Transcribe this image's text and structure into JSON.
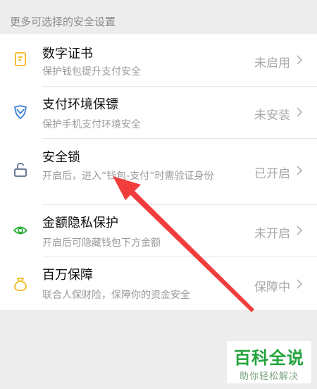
{
  "section_header": "更多可选择的安全设置",
  "items": [
    {
      "title": "数字证书",
      "subtitle": "保护钱包提升支付安全",
      "status": "未启用",
      "icon": "certificate-icon",
      "icon_color": "#f2b91c"
    },
    {
      "title": "支付环境保镖",
      "subtitle": "保护手机支付环境安全",
      "status": "未安装",
      "icon": "shield-icon",
      "icon_color": "#3d7fd6"
    },
    {
      "title": "安全锁",
      "subtitle": "开启后，进入“钱包-支付”时需验证身份",
      "status": "已开启",
      "icon": "lock-icon",
      "icon_color": "#5a6b8c"
    },
    {
      "title": "金额隐私保护",
      "subtitle": "开启后可隐藏钱包下方金额",
      "status": "未开启",
      "icon": "eye-icon",
      "icon_color": "#2aae3a"
    },
    {
      "title": "百万保障",
      "subtitle": "联合人保财险，保障你的资金安全",
      "status": "保障中",
      "icon": "money-bag-icon",
      "icon_color": "#f2b91c"
    }
  ],
  "watermark": {
    "title": "百科全说",
    "subtitle": "助你轻松解决"
  },
  "colors": {
    "annotation_arrow": "#f23d3d",
    "watermark_green": "#22a33a"
  }
}
